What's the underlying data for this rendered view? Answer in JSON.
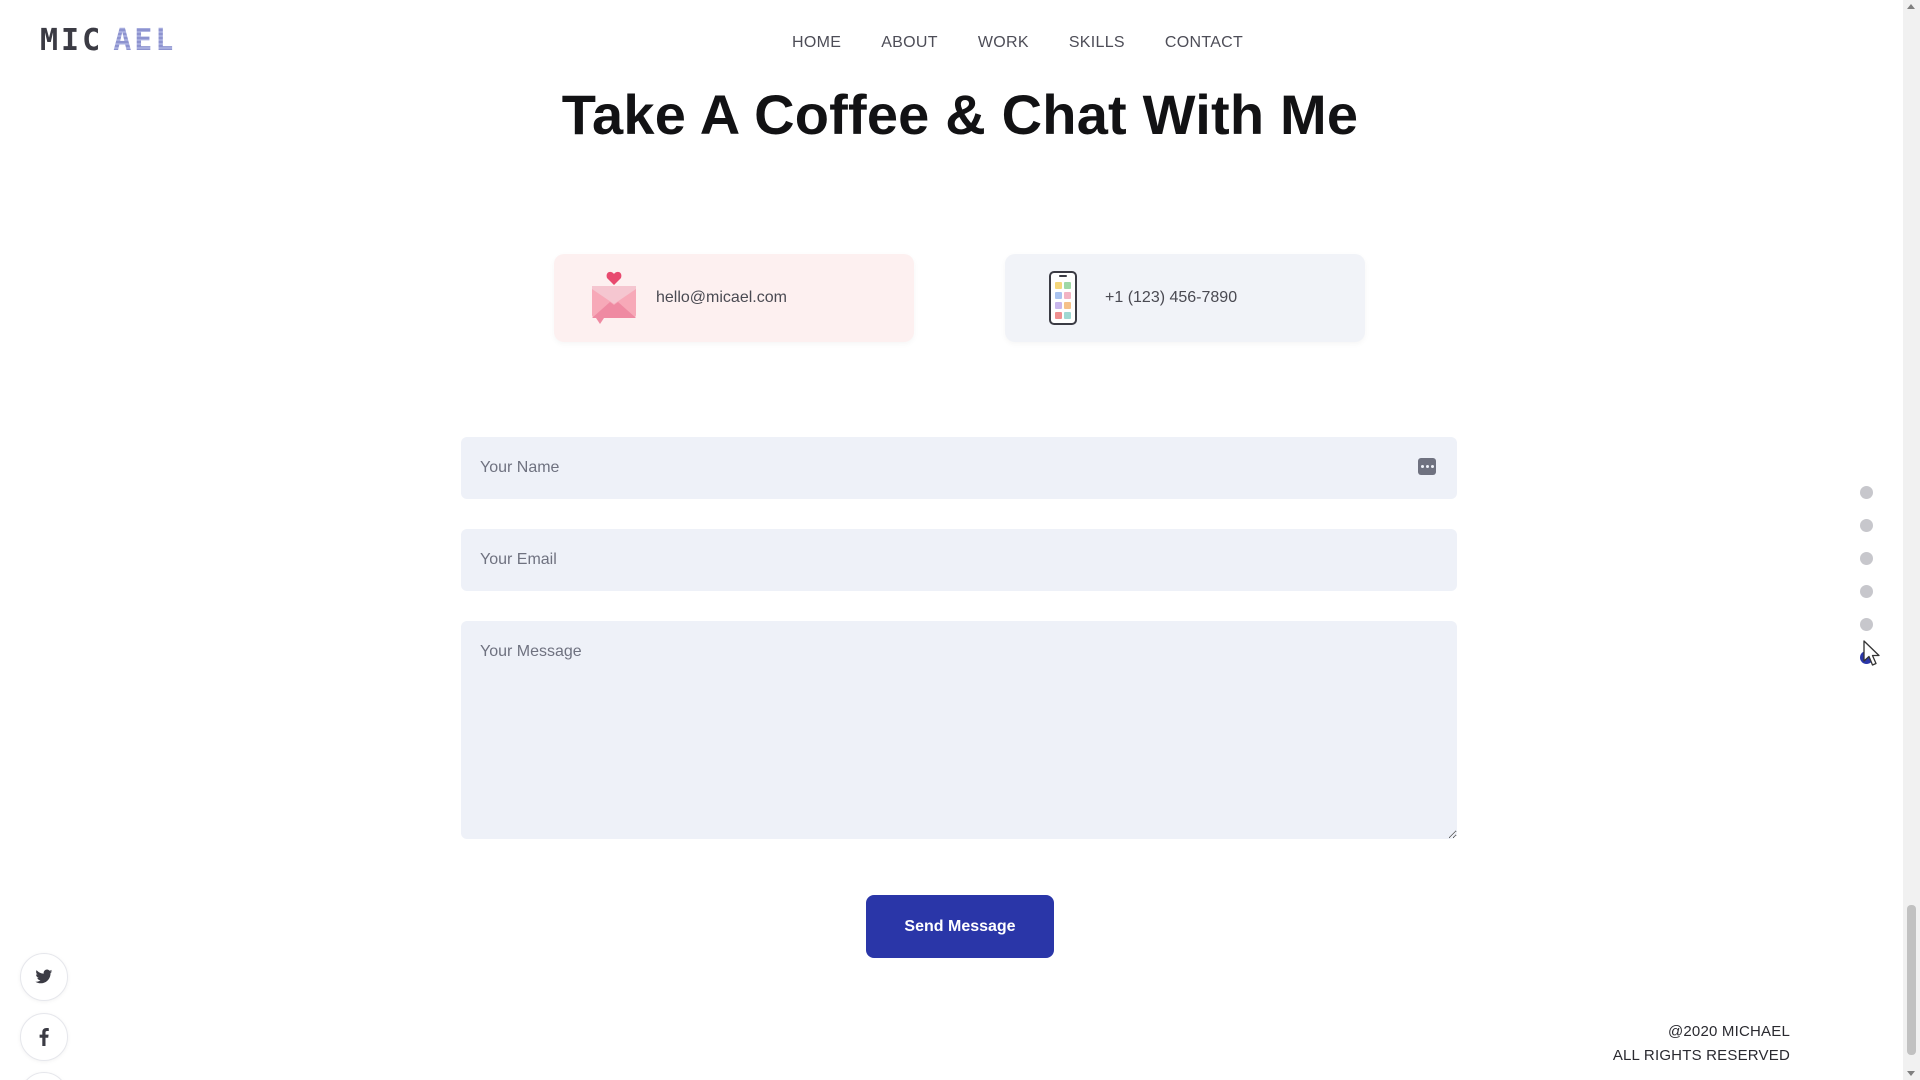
{
  "brand": {
    "logo_part1": "MIC",
    "logo_part2": "AEL"
  },
  "nav": {
    "items": [
      {
        "label": "HOME"
      },
      {
        "label": "ABOUT"
      },
      {
        "label": "WORK"
      },
      {
        "label": "SKILLS"
      },
      {
        "label": "CONTACT"
      }
    ]
  },
  "section": {
    "title": "Take A Coffee & Chat With Me"
  },
  "contact": {
    "email": "hello@micael.com",
    "phone": "+1 (123) 456-7890"
  },
  "form": {
    "name_placeholder": "Your Name",
    "email_placeholder": "Your Email",
    "message_placeholder": "Your Message",
    "submit_label": "Send Message"
  },
  "social": {
    "icons": [
      "twitter-icon",
      "facebook-icon"
    ]
  },
  "footer": {
    "line1": "@2020 MICHAEL",
    "line2": "ALL RIGHTS RESERVED"
  },
  "section_dots": {
    "count": 6,
    "active_index": 5
  },
  "colors": {
    "accent": "#2a36a8",
    "email_card_bg": "#fdf0f0",
    "phone_card_bg": "#f1f3f8",
    "field_bg": "#eef1f8"
  }
}
